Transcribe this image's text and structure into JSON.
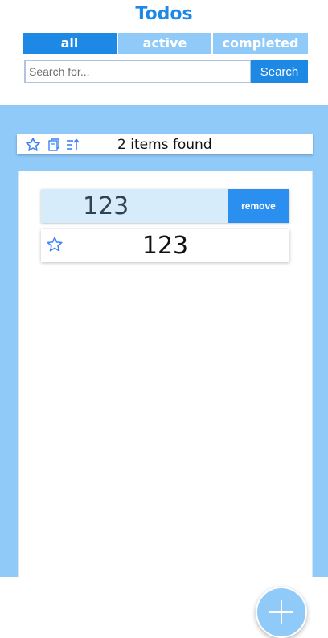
{
  "header": {
    "title": "Todos"
  },
  "tabs": [
    {
      "label": "all",
      "selected": true
    },
    {
      "label": "active",
      "selected": false
    },
    {
      "label": "completed",
      "selected": false
    }
  ],
  "search": {
    "placeholder": "Search for...",
    "value": "",
    "button_label": "Search"
  },
  "toolbar": {
    "icons": [
      "star-outline-icon",
      "copy-icon",
      "sort-icon"
    ],
    "count_text": "2 items found"
  },
  "list": {
    "items": [
      {
        "text": "123",
        "selected": true,
        "action_label": "remove",
        "starred": false
      },
      {
        "text": "123",
        "selected": false,
        "starred": false
      }
    ]
  },
  "fab": {
    "icon": "plus-icon"
  },
  "colors": {
    "accent": "#1e88e5",
    "light_accent": "#90caf9",
    "selected_row": "#d6ecfb",
    "remove_button": "#2b8ff0"
  }
}
